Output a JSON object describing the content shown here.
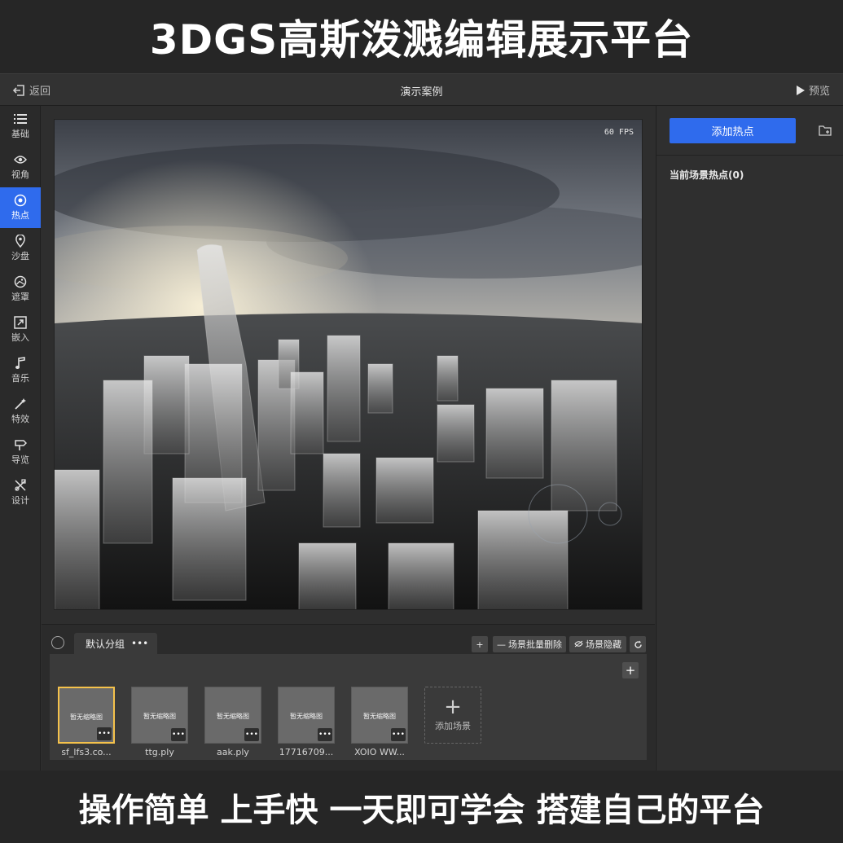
{
  "banner": {
    "top_title": "3DGS高斯泼溅编辑展示平台",
    "bottom_slogan": "操作简单 上手快 一天即可学会 搭建自己的平台"
  },
  "topbar": {
    "back_label": "返回",
    "title": "演示案例",
    "preview_label": "预览"
  },
  "sidebar": {
    "items": [
      {
        "label": "基础",
        "icon": "list-icon"
      },
      {
        "label": "视角",
        "icon": "eye-icon"
      },
      {
        "label": "热点",
        "icon": "target-icon",
        "active": true
      },
      {
        "label": "沙盘",
        "icon": "pin-icon"
      },
      {
        "label": "遮罩",
        "icon": "image-icon"
      },
      {
        "label": "嵌入",
        "icon": "embed-icon"
      },
      {
        "label": "音乐",
        "icon": "music-icon"
      },
      {
        "label": "特效",
        "icon": "wand-icon"
      },
      {
        "label": "导览",
        "icon": "signpost-icon"
      },
      {
        "label": "设计",
        "icon": "design-icon"
      }
    ]
  },
  "viewport": {
    "fps": "60 FPS"
  },
  "bottom": {
    "group_tab": "默认分组",
    "group_more": "•••",
    "add_button": "+",
    "batch_delete": "场景批量删除",
    "hide_scene": "场景隐藏",
    "scenes": [
      {
        "thumb": "暂无缩略图",
        "name": "sf_lfs3.co...",
        "selected": true
      },
      {
        "thumb": "暂无缩略图",
        "name": "ttg.ply"
      },
      {
        "thumb": "暂无缩略图",
        "name": "aak.ply"
      },
      {
        "thumb": "暂无缩略图",
        "name": "17716709..."
      },
      {
        "thumb": "暂无缩略图",
        "name": "XOIO WW..."
      }
    ],
    "more_label": "•••",
    "add_scene": "添加场景"
  },
  "right_panel": {
    "add_hotspot": "添加热点",
    "hotspot_count": "当前场景热点(0)"
  },
  "colors": {
    "accent": "#2f6bed",
    "selected_border": "#f5c24b"
  }
}
